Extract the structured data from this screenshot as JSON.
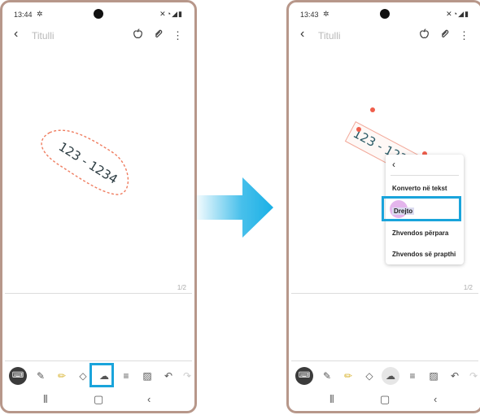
{
  "left_phone": {
    "status": {
      "time": "13:44"
    },
    "title_placeholder": "Titulli",
    "handwriting": "123 - 1234",
    "page_indicator": "1/2"
  },
  "right_phone": {
    "status": {
      "time": "13:43"
    },
    "title_placeholder": "Titulli",
    "handwriting": "123 - 1234",
    "page_indicator": "1/2",
    "context_menu": {
      "items": [
        "Konverto në tekst",
        "Drejto",
        "Zhvendos përpara",
        "Zhvendos së prapthi"
      ]
    }
  },
  "colors": {
    "highlight": "#1aa4db",
    "lasso": "#ef7c5f",
    "ink": "#2a5a66",
    "frame": "#b7978a"
  },
  "icons": [
    "settings-icon",
    "camera-cutout",
    "mute-icon",
    "wifi-icon",
    "signal-icon",
    "battery-icon",
    "back-arrow-icon",
    "apple-icon",
    "paperclip-icon",
    "more-icon",
    "keyboard-icon",
    "pen-icon",
    "highlighter-icon",
    "eraser-icon",
    "lasso-icon",
    "text-format-icon",
    "image-text-icon",
    "undo-icon",
    "redo-icon",
    "recents-icon",
    "home-icon",
    "nav-back-icon",
    "arrow-right-icon"
  ]
}
